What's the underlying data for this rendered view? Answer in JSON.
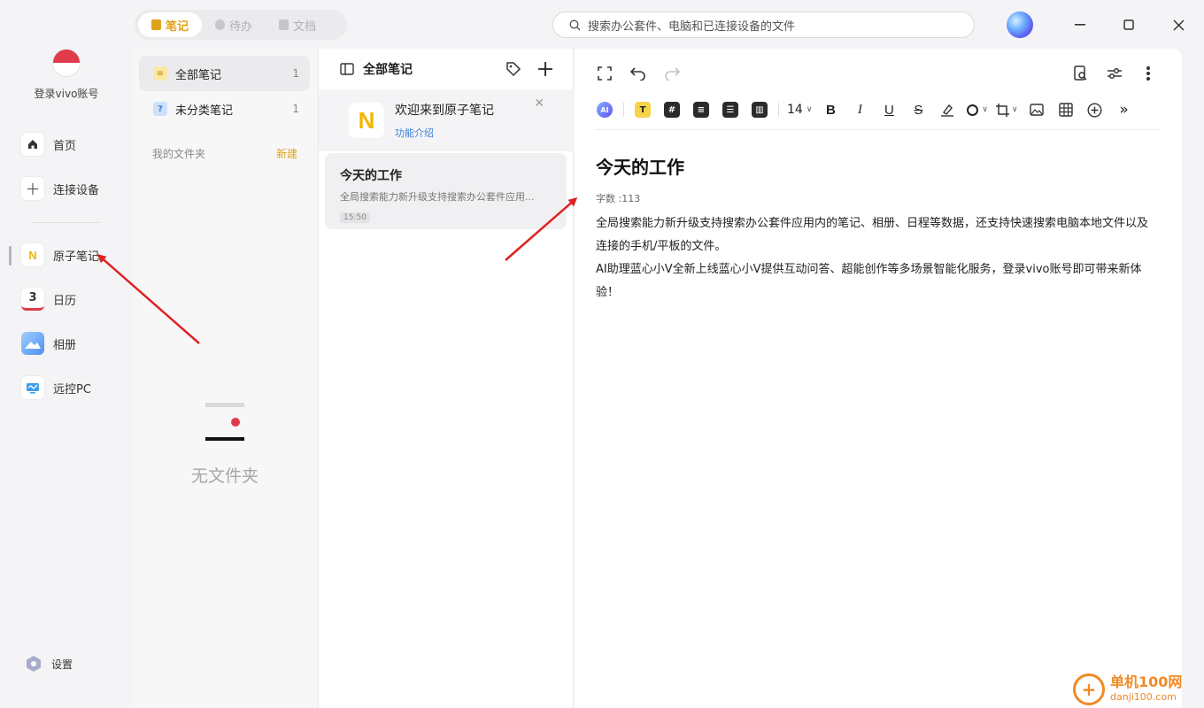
{
  "top_tabs": [
    {
      "label": "笔记",
      "active": true
    },
    {
      "label": "待办",
      "active": false
    },
    {
      "label": "文档",
      "active": false
    }
  ],
  "search": {
    "placeholder": "搜索办公套件、电脑和已连接设备的文件"
  },
  "sidebar": {
    "login_label": "登录vivo账号",
    "items": [
      {
        "label": "首页",
        "icon": "home-icon"
      },
      {
        "label": "连接设备",
        "icon": "plus-icon"
      },
      {
        "label": "原子笔记",
        "icon": "atom-notes-app-icon"
      },
      {
        "label": "日历",
        "icon": "calendar-app-icon",
        "icon_text": "3"
      },
      {
        "label": "相册",
        "icon": "gallery-app-icon"
      },
      {
        "label": "远控PC",
        "icon": "remote-pc-app-icon"
      }
    ],
    "settings_label": "设置"
  },
  "folders": {
    "items": [
      {
        "label": "全部笔记",
        "count": "1"
      },
      {
        "label": "未分类笔记",
        "count": "1"
      }
    ],
    "my_folders_label": "我的文件夹",
    "new_label": "新建",
    "empty_text": "无文件夹"
  },
  "note_list": {
    "title": "全部笔记",
    "welcome": {
      "title": "欢迎来到原子笔记",
      "link": "功能介绍",
      "logo_letter": "N"
    },
    "notes": [
      {
        "title": "今天的工作",
        "preview": "全局搜索能力新升级支持搜索办公套件应用...",
        "time": "15:50"
      }
    ]
  },
  "editor": {
    "font_size": "14",
    "ai_label": "AI",
    "title": "今天的工作",
    "word_count": "字数 :113",
    "paragraphs": [
      "全局搜索能力新升级支持搜索办公套件应用内的笔记、相册、日程等数据，还支持快速搜索电脑本地文件以及连接的手机/平板的文件。",
      "AI助理蓝心小V全新上线蓝心小V提供互动问答、超能创作等多场景智能化服务，登录vivo账号即可带来新体验！"
    ]
  },
  "watermark": {
    "name": "单机100网",
    "url": "danji100.com"
  },
  "colors": {
    "accent": "#e0a21a",
    "link": "#3d7fd9",
    "annotation_arrow": "#e02020"
  }
}
